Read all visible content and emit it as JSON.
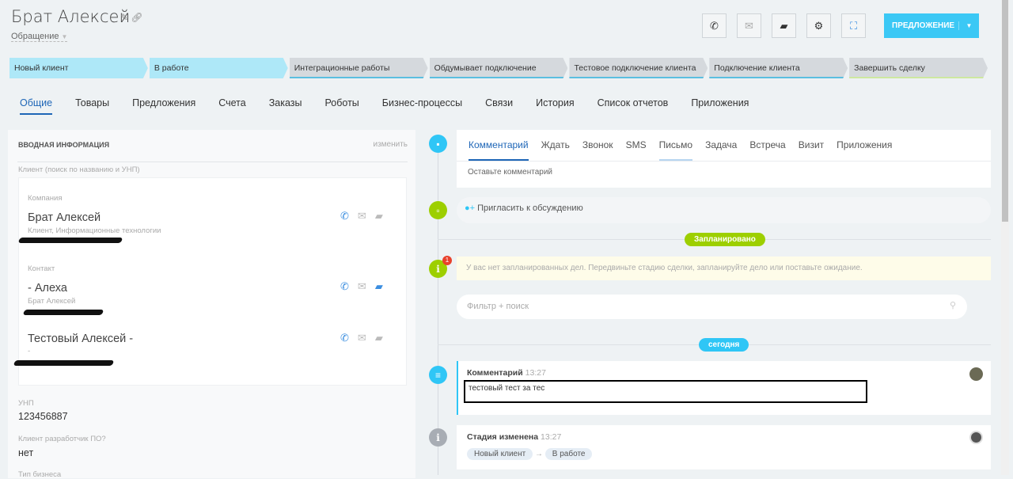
{
  "header": {
    "title": "Брат Алексей",
    "subtitle": "Обращение",
    "proposal_button": "ПРЕДЛОЖЕНИЕ"
  },
  "stages": [
    "Новый клиент",
    "В работе",
    "Интеграционные работы",
    "Обдумывает подключение",
    "Тестовое подключение клиента",
    "Подключение клиента",
    "Завершить сделку"
  ],
  "tabs": [
    "Общие",
    "Товары",
    "Предложения",
    "Счета",
    "Заказы",
    "Роботы",
    "Бизнес-процессы",
    "Связи",
    "История",
    "Список отчетов",
    "Приложения"
  ],
  "left": {
    "section_title": "ВВОДНАЯ ИНФОРМАЦИЯ",
    "edit_link": "изменить",
    "client_label": "Клиент (поиск по названию и УНП)",
    "company_label": "Компания",
    "company_name": "Брат Алексей",
    "company_sub": "Клиент, Информационные технологии",
    "contact_label": "Контакт",
    "contact1_name": "- Алеха",
    "contact1_sub": "Брат Алексей",
    "contact2_name": "Тестовый Алексей -",
    "contact2_sub": "-",
    "unp_label": "УНП",
    "unp_value": "123456887",
    "dev_label": "Клиент разработчик ПО?",
    "dev_value": "нет",
    "business_label": "Тип бизнеса"
  },
  "timeline": {
    "tabs": [
      "Комментарий",
      "Ждать",
      "Звонок",
      "SMS",
      "Письмо",
      "Задача",
      "Встреча",
      "Визит",
      "Приложения"
    ],
    "comment_placeholder": "Оставьте комментарий",
    "invite": "Пригласить к обсуждению",
    "planned": "Запланировано",
    "notice": "У вас нет запланированных дел. Передвиньте стадию сделки, запланируйте дело или поставьте ожидание.",
    "notice_badge": "1",
    "filter_placeholder": "Фильтр + поиск",
    "today": "сегодня",
    "comment": {
      "title": "Комментарий",
      "time": "13:27",
      "text": "тестовый тест за тес"
    },
    "stage_change": {
      "title": "Стадия изменена",
      "time": "13:27",
      "from": "Новый клиент",
      "to": "В работе"
    }
  },
  "colors": {
    "accent": "#3bc8f5",
    "green": "#9dcf00",
    "link": "#1e66b7"
  }
}
